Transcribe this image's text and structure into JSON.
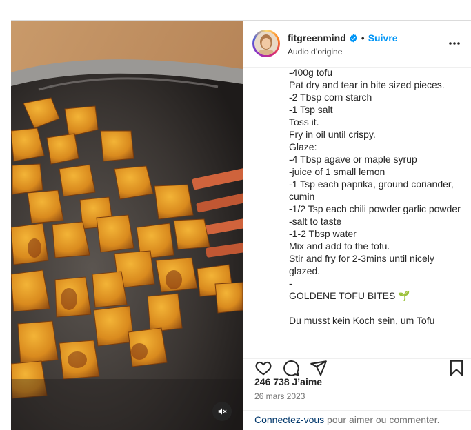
{
  "post": {
    "username": "fitgreenmind",
    "separator": "•",
    "follow_label": "Suivre",
    "audio": "Audio d’origine",
    "caption_lines": [
      "-400g tofu",
      "Pat dry and tear in bite sized pieces.",
      "-2 Tbsp corn starch",
      "-1 Tsp salt",
      "Toss it.",
      "Fry in oil until crispy.",
      "Glaze:",
      "-4 Tbsp agave or maple syrup",
      "-juice of 1 small lemon",
      "-1 Tsp each paprika, ground coriander, cumin",
      "-1/2 Tsp each chili powder garlic powder",
      "-salt to taste",
      "-1-2 Tbsp water",
      "Mix and add to the tofu.",
      "Stir and fry for 2-3mins until nicely glazed.",
      "-",
      "GOLDENE TOFU BITES 🌱",
      "",
      "Du musst kein Koch sein, um Tofu"
    ],
    "likes": "246 738 J’aime",
    "date": "26 mars 2023"
  },
  "footer": {
    "login_link": "Connectez-vous",
    "login_rest": " pour aimer ou commenter."
  },
  "icons": {
    "verified": "verified-badge-icon",
    "more": "more-options-icon",
    "like": "heart-icon",
    "comment": "comment-icon",
    "share": "share-icon",
    "save": "bookmark-icon",
    "mute": "sound-off-icon"
  },
  "colors": {
    "accent": "#0095f6",
    "link": "#00376b",
    "muted_text": "#737373",
    "text": "#262626"
  }
}
